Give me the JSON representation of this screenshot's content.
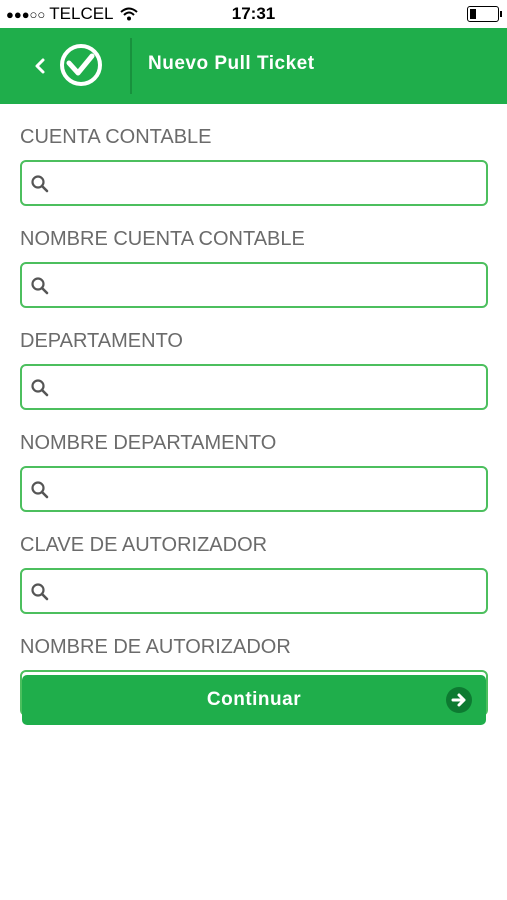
{
  "status": {
    "signal": "●●●○○",
    "carrier": "TELCEL",
    "time": "17:31"
  },
  "header": {
    "title": "Nuevo Pull Ticket",
    "accent_color": "#1fae4b"
  },
  "fields": [
    {
      "label": "CUENTA CONTABLE",
      "value": ""
    },
    {
      "label": "NOMBRE CUENTA CONTABLE",
      "value": ""
    },
    {
      "label": "DEPARTAMENTO",
      "value": ""
    },
    {
      "label": "NOMBRE DEPARTAMENTO",
      "value": ""
    },
    {
      "label": "CLAVE DE AUTORIZADOR",
      "value": ""
    },
    {
      "label": "NOMBRE DE AUTORIZADOR",
      "value": ""
    }
  ],
  "continue_button": {
    "label": "Continuar",
    "icon": "arrow-right-icon"
  }
}
